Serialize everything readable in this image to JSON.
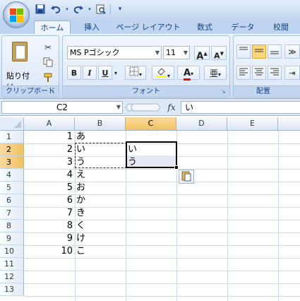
{
  "title_bar": {
    "quick_access": [
      {
        "name": "save",
        "glyph": "💾"
      },
      {
        "name": "undo",
        "glyph": "↶"
      },
      {
        "name": "redo",
        "glyph": "↷"
      },
      {
        "name": "print-preview",
        "glyph": "🔍"
      },
      {
        "name": "customize",
        "glyph": "▾"
      }
    ]
  },
  "tabs": [
    {
      "label": "ホーム",
      "active": true
    },
    {
      "label": "挿入",
      "active": false
    },
    {
      "label": "ページ レイアウト",
      "active": false
    },
    {
      "label": "数式",
      "active": false
    },
    {
      "label": "データ",
      "active": false
    },
    {
      "label": "校閲",
      "active": false
    }
  ],
  "ribbon": {
    "clipboard": {
      "paste_label": "貼り付け",
      "group_label": "クリップボード"
    },
    "font": {
      "font_name": "MS Pゴシック",
      "font_size": "11",
      "grow_label": "A",
      "shrink_label": "A",
      "bold": "B",
      "italic": "I",
      "underline": "U",
      "font_color_label": "A",
      "phonetic_label": "亜",
      "group_label": "フォント"
    },
    "alignment": {
      "group_label": "配置"
    }
  },
  "formula_bar": {
    "name_box": "C2",
    "fx_label": "fx",
    "content": "い"
  },
  "grid": {
    "columns": [
      "A",
      "B",
      "C",
      "D",
      "E"
    ],
    "selected_column": "C",
    "rows": [
      "1",
      "2",
      "3",
      "4",
      "5",
      "6",
      "7",
      "8",
      "9",
      "10",
      "11",
      "12",
      "13"
    ],
    "selected_rows": [
      "2",
      "3"
    ],
    "col_a": [
      "1",
      "2",
      "3",
      "4",
      "5",
      "6",
      "7",
      "8",
      "9",
      "10"
    ],
    "col_b": [
      "あ",
      "い",
      "う",
      "え",
      "お",
      "か",
      "き",
      "く",
      "け",
      "こ"
    ],
    "col_c": [
      "い",
      "う"
    ]
  },
  "colors": {
    "ribbon_bg": "#dae6f6",
    "selection_header": "#f1c15f",
    "grid_line": "#d0d7e5"
  }
}
